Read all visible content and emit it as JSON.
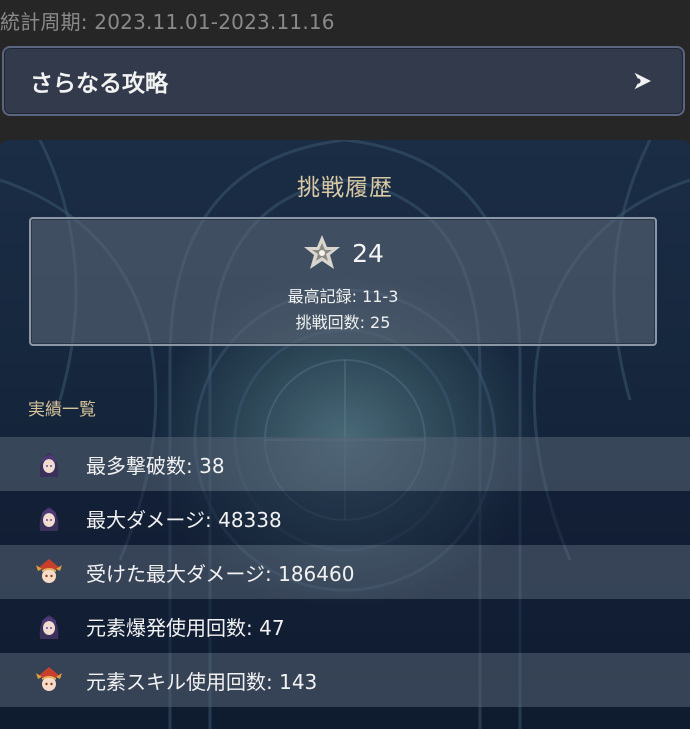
{
  "header": {
    "period": "統計周期: 2023.11.01-2023.11.16"
  },
  "more_button": {
    "label": "さらなる攻略",
    "icon": "forward-arrow-icon"
  },
  "panel": {
    "title": "挑戦履歴",
    "record": {
      "icon": "abyss-star-icon",
      "value": "24",
      "best": "最高記録: 11-3",
      "tries": "挑戦回数: 25"
    },
    "section_title": "実績一覧",
    "stats": [
      {
        "text": "最多撃破数: 38",
        "avatar": "purple-hair-character-avatar"
      },
      {
        "text": "最大ダメージ: 48338",
        "avatar": "purple-hair-character-avatar"
      },
      {
        "text": "受けた最大ダメージ: 186460",
        "avatar": "red-hat-character-avatar"
      },
      {
        "text": "元素爆発使用回数: 47",
        "avatar": "purple-hair-character-avatar"
      },
      {
        "text": "元素スキル使用回数: 143",
        "avatar": "red-hat-character-avatar"
      }
    ]
  },
  "colors": {
    "background": "#262626",
    "title_gold": "#d9c9a4",
    "button_bg": "#323a4b",
    "button_border": "#5a6580",
    "row_light": "#566274",
    "row_dark": "#121e34"
  }
}
